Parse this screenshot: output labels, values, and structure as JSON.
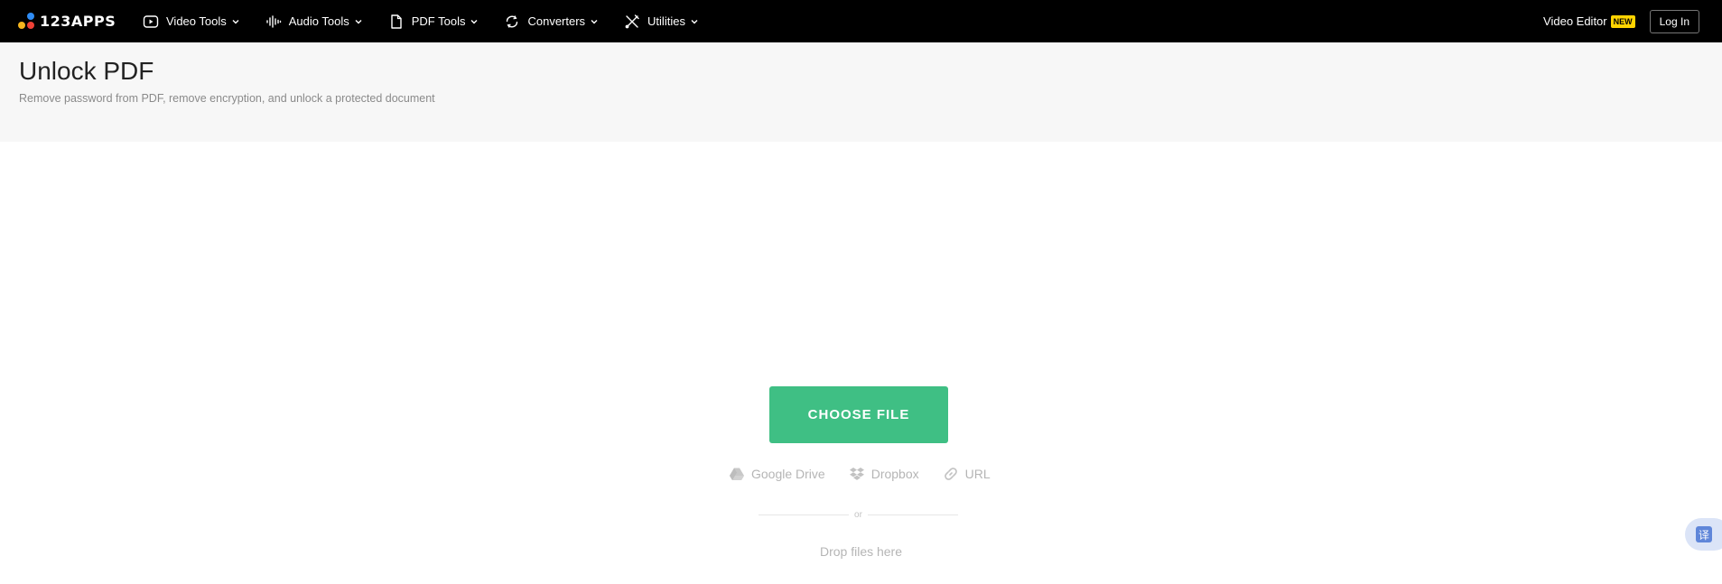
{
  "brand": {
    "logo_text": "123APPS"
  },
  "nav": {
    "items": [
      {
        "label": "Video Tools",
        "icon": "play-circle-icon"
      },
      {
        "label": "Audio Tools",
        "icon": "waveform-icon"
      },
      {
        "label": "PDF Tools",
        "icon": "document-icon"
      },
      {
        "label": "Converters",
        "icon": "convert-cycle-icon"
      },
      {
        "label": "Utilities",
        "icon": "tools-icon"
      }
    ],
    "video_editor_label": "Video Editor",
    "new_badge": "NEW",
    "login_label": "Log In"
  },
  "header": {
    "title": "Unlock PDF",
    "subtitle": "Remove password from PDF, remove encryption, and unlock a protected document"
  },
  "upload": {
    "choose_file_label": "CHOOSE FILE",
    "sources": [
      {
        "label": "Google Drive",
        "icon": "google-drive-icon"
      },
      {
        "label": "Dropbox",
        "icon": "dropbox-icon"
      },
      {
        "label": "URL",
        "icon": "link-icon"
      }
    ],
    "or_text": "or",
    "drop_text": "Drop files here"
  },
  "translate_fab": {
    "glyph": "译"
  },
  "colors": {
    "topbar": "#000000",
    "header_bg": "#f7f7f7",
    "accent": "#3fbf84",
    "badge": "#ffd400"
  }
}
